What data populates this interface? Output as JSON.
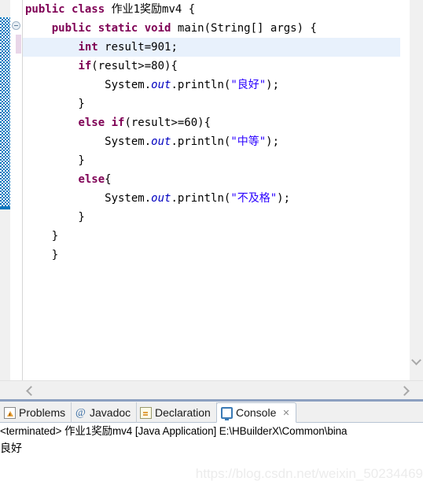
{
  "editor": {
    "language": "java",
    "highlighted_line_index": 2,
    "colors": {
      "keyword": "#7F0055",
      "string": "#2A00FF",
      "field": "#0000C0",
      "plain": "#000000",
      "current_line_highlight": "#E8F1FC",
      "overview_marker": "#0A76BD",
      "change_bar": "#E9D6E9"
    },
    "fold_marker_icon": "collapse-minus-icon",
    "lines": [
      [
        {
          "t": "public",
          "c": "kw"
        },
        {
          "t": " ",
          "c": "pln"
        },
        {
          "t": "class",
          "c": "kw"
        },
        {
          "t": " 作业1奖励mv4 {",
          "c": "pln"
        }
      ],
      [
        {
          "t": "    ",
          "c": "pln"
        },
        {
          "t": "public",
          "c": "kw"
        },
        {
          "t": " ",
          "c": "pln"
        },
        {
          "t": "static",
          "c": "kw"
        },
        {
          "t": " ",
          "c": "pln"
        },
        {
          "t": "void",
          "c": "kw"
        },
        {
          "t": " main(String[] args) {",
          "c": "pln"
        }
      ],
      [
        {
          "t": "        ",
          "c": "pln"
        },
        {
          "t": "int",
          "c": "kw"
        },
        {
          "t": " result=901;",
          "c": "pln"
        }
      ],
      [
        {
          "t": "        ",
          "c": "pln"
        },
        {
          "t": "if",
          "c": "kw"
        },
        {
          "t": "(result>=80){",
          "c": "pln"
        }
      ],
      [
        {
          "t": "            System.",
          "c": "pln"
        },
        {
          "t": "out",
          "c": "fld"
        },
        {
          "t": ".println(",
          "c": "pln"
        },
        {
          "t": "\"良好\"",
          "c": "str"
        },
        {
          "t": ");",
          "c": "pln"
        }
      ],
      [
        {
          "t": "        }",
          "c": "pln"
        }
      ],
      [
        {
          "t": "        ",
          "c": "pln"
        },
        {
          "t": "else",
          "c": "kw"
        },
        {
          "t": " ",
          "c": "pln"
        },
        {
          "t": "if",
          "c": "kw"
        },
        {
          "t": "(result>=60){",
          "c": "pln"
        }
      ],
      [
        {
          "t": "            System.",
          "c": "pln"
        },
        {
          "t": "out",
          "c": "fld"
        },
        {
          "t": ".println(",
          "c": "pln"
        },
        {
          "t": "\"中等\"",
          "c": "str"
        },
        {
          "t": ");",
          "c": "pln"
        }
      ],
      [
        {
          "t": "        }",
          "c": "pln"
        }
      ],
      [
        {
          "t": "        ",
          "c": "pln"
        },
        {
          "t": "else",
          "c": "kw"
        },
        {
          "t": "{",
          "c": "pln"
        }
      ],
      [
        {
          "t": "            System.",
          "c": "pln"
        },
        {
          "t": "out",
          "c": "fld"
        },
        {
          "t": ".println(",
          "c": "pln"
        },
        {
          "t": "\"不及格\"",
          "c": "str"
        },
        {
          "t": ");",
          "c": "pln"
        }
      ],
      [
        {
          "t": "        }",
          "c": "pln"
        }
      ],
      [
        {
          "t": "    }",
          "c": "pln"
        }
      ],
      [
        {
          "t": "    }",
          "c": "pln"
        }
      ]
    ]
  },
  "scrollbars": {
    "vertical_down_icon": "chevron-down-icon",
    "horizontal_left_icon": "chevron-left-icon",
    "horizontal_right_icon": "chevron-right-icon"
  },
  "bottom_panel": {
    "tabs": [
      {
        "label": "Problems",
        "icon": "problems-icon",
        "active": false,
        "closeable": false
      },
      {
        "label": "Javadoc",
        "icon": "javadoc-at-icon",
        "active": false,
        "closeable": false
      },
      {
        "label": "Declaration",
        "icon": "declaration-icon",
        "active": false,
        "closeable": false
      },
      {
        "label": "Console",
        "icon": "console-icon",
        "active": true,
        "closeable": true
      }
    ],
    "close_glyph": "✕",
    "console": {
      "header": "<terminated> 作业1奖励mv4 [Java Application] E:\\HBuilderX\\Common\\bina",
      "output": "良好"
    }
  },
  "watermark": {
    "text": "https://blog.csdn.net/weixin_50234469"
  }
}
